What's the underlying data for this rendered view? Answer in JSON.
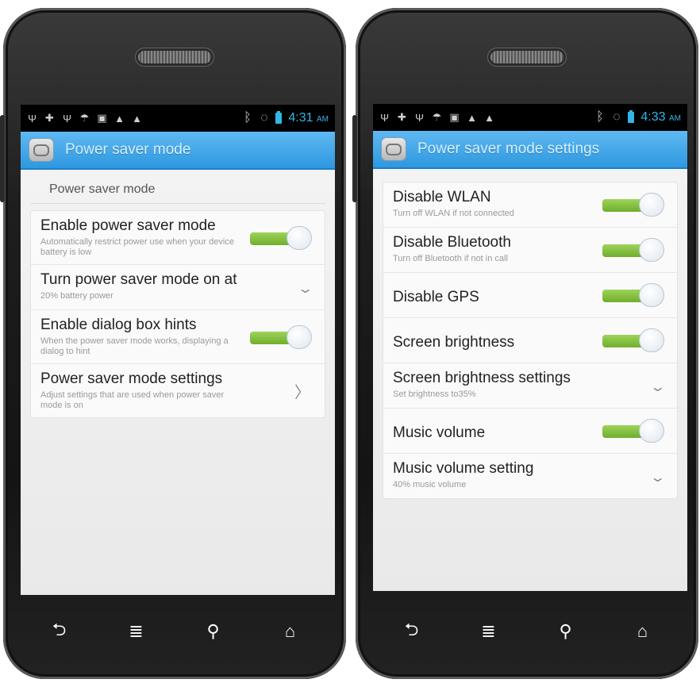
{
  "left": {
    "status_time": "4:31",
    "status_ampm": "AM",
    "title": "Power saver mode",
    "section_title": "Power saver mode",
    "rows": [
      {
        "title": "Enable power saver mode",
        "sub": "Automatically restrict power use when your device battery is low",
        "control": "toggle",
        "on": true
      },
      {
        "title": "Turn power saver mode on at",
        "sub": "20% battery power",
        "control": "dropdown"
      },
      {
        "title": "Enable dialog box hints",
        "sub": "When the power saver mode works, displaying a dialog to hint",
        "control": "toggle",
        "on": true
      },
      {
        "title": "Power saver mode settings",
        "sub": "Adjust settings that are used when power saver mode is on",
        "control": "arrow"
      }
    ]
  },
  "right": {
    "status_time": "4:33",
    "status_ampm": "AM",
    "title": "Power saver mode settings",
    "rows": [
      {
        "title": "Disable WLAN",
        "sub": "Turn off WLAN if not connected",
        "control": "toggle",
        "on": true
      },
      {
        "title": "Disable Bluetooth",
        "sub": "Turn off Bluetooth if not in call",
        "control": "toggle",
        "on": true
      },
      {
        "title": "Disable GPS",
        "sub": "",
        "control": "toggle",
        "on": true
      },
      {
        "title": "Screen brightness",
        "sub": "",
        "control": "toggle",
        "on": true
      },
      {
        "title": "Screen brightness settings",
        "sub": "Set brightness to35%",
        "control": "dropdown"
      },
      {
        "title": "Music volume",
        "sub": "",
        "control": "toggle",
        "on": true
      },
      {
        "title": "Music volume setting",
        "sub": "40% music volume",
        "control": "dropdown"
      }
    ]
  },
  "nav": {
    "back": "back-icon",
    "menu": "menu-icon",
    "search": "search-icon",
    "home": "home-icon"
  },
  "colors": {
    "accent": "#33b5e5",
    "actionbar": "#2e98e0",
    "toggle_on": "#7cbd35"
  }
}
